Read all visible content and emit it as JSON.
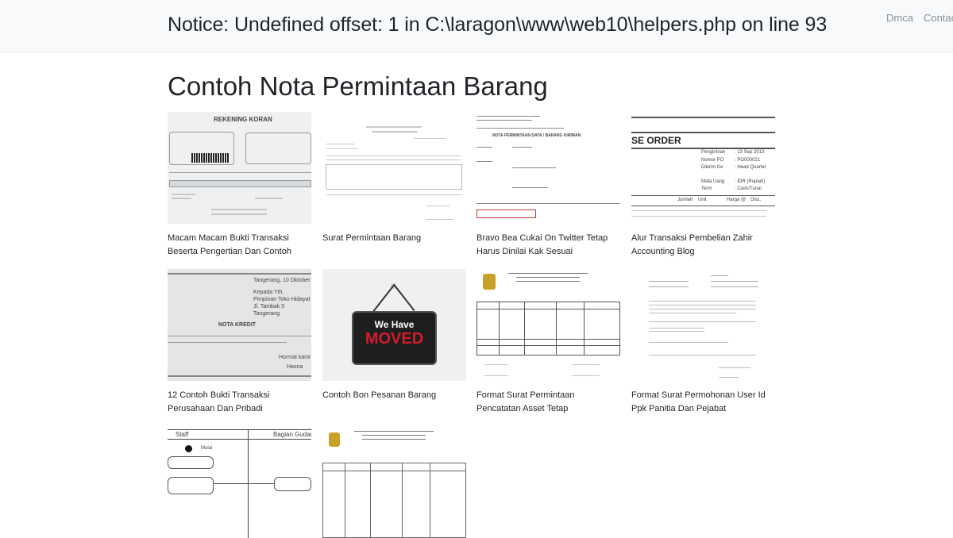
{
  "header": {
    "notice": "Notice: Undefined offset: 1 in C:\\laragon\\www\\web10\\helpers.php on line 93",
    "nav_links": [
      "Dmca",
      "Contact"
    ]
  },
  "page_title": "Contoh Nota Permintaan Barang",
  "gallery": [
    {
      "caption": "Macam Macam Bukti Transaksi Beserta Pengertian Dan Contoh",
      "thumb_text": "REKENING KORAN",
      "thumb": "bank-statement"
    },
    {
      "caption": "Surat Permintaan Barang",
      "thumb_text": "",
      "thumb": "request-letter"
    },
    {
      "caption": "Bravo Bea Cukai On Twitter Tetap Harus Dinilai Kak Sesuai",
      "thumb_text": "NOTA PERMINTAAN DATA / BARANG KIRIMAN",
      "thumb": "customs-form"
    },
    {
      "caption": "Alur Transaksi Pembelian Zahir Accounting Blog",
      "thumb_text": "SE ORDER",
      "thumb": "purchase-order"
    },
    {
      "caption": "12 Contoh Bukti Transaksi Perusahaan Dan Pribadi",
      "thumb_text": "NOTA KREDIT",
      "thumb": "credit-note"
    },
    {
      "caption": "Contoh Bon Pesanan Barang",
      "thumb_text": "We Have MOVED",
      "thumb": "moved-sign"
    },
    {
      "caption": "Format Surat Permintaan Pencatatan Asset Tetap",
      "thumb_text": "",
      "thumb": "asset-form"
    },
    {
      "caption": "Format Surat Permohonan User Id Ppk Panitia Dan Pejabat",
      "thumb_text": "",
      "thumb": "user-id-letter"
    },
    {
      "caption": "",
      "thumb_text": "Staff / Bagian Gudang",
      "thumb": "flowchart"
    },
    {
      "caption": "",
      "thumb_text": "",
      "thumb": "asset-form-2"
    }
  ],
  "thumb_details": {
    "credit_note": {
      "date": "Tangerang, 10 Oktober",
      "to": "Kepada Yth.",
      "recipient": "Pimpinan Toko Hidayat",
      "street": "Jl. Tambak 5",
      "city": "Tangerang",
      "closing": "Hormat kami",
      "signer": "Hasna"
    },
    "purchase_order": {
      "rows": [
        [
          "Pengiriman",
          ": 13 Sep 2013"
        ],
        [
          "Nomor PO",
          ": PO000021"
        ],
        [
          "Dikirim Ke",
          ": Head Quarter"
        ],
        [
          "Mata Uang",
          ": IDR (Rupiah)"
        ],
        [
          "Term",
          ": Cash/Tunai"
        ]
      ],
      "cols": [
        "Jumlah",
        "Unit",
        "Harga @",
        "Disc."
      ]
    },
    "flowchart": {
      "lane1": "Staff",
      "lane2": "Bagian Gudang",
      "start": "Mulai"
    },
    "moved": {
      "line1": "We Have",
      "line2": "MOVED"
    }
  }
}
